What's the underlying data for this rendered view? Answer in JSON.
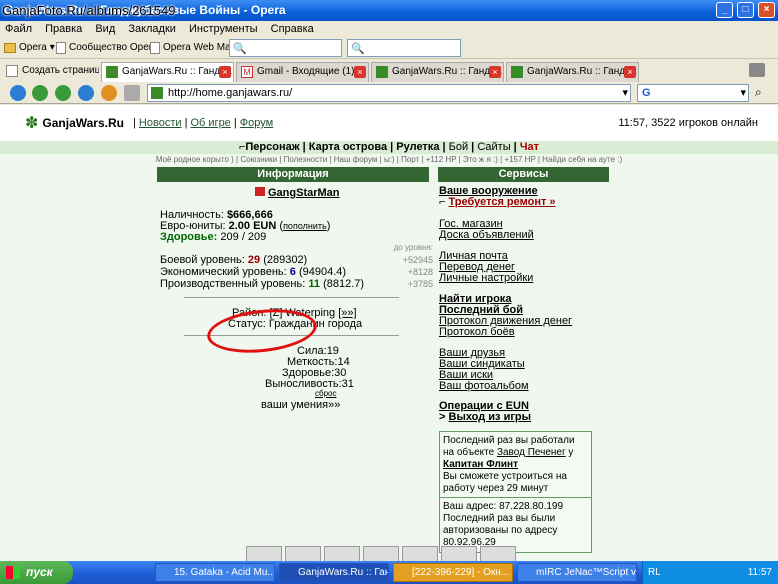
{
  "window": {
    "title": "GanjaWars.Ru :: Ганджубасовые Войны - Opera",
    "watermark": "GanjaFoto.Ru/albums/261549"
  },
  "menu": [
    "Файл",
    "Правка",
    "Вид",
    "Закладки",
    "Инструменты",
    "Справка"
  ],
  "personal_bar": {
    "opera": "Opera",
    "community": "Сообщество Opera",
    "webmail": "Opera Web Mail"
  },
  "tabs": {
    "new_tab": "Создать страницу",
    "items": [
      {
        "label": "GanjaWars.Ru :: Гандж...",
        "active": true
      },
      {
        "label": "Gmail - Входящие (1)",
        "active": false
      },
      {
        "label": "GanjaWars.Ru :: Гандж...",
        "active": false
      },
      {
        "label": "GanjaWars.Ru :: Гандж...",
        "active": false
      }
    ]
  },
  "address": {
    "url": "http://home.ganjawars.ru/",
    "search_engine": "G"
  },
  "site": {
    "logo": "GanjaWars.Ru",
    "links": [
      "Новости",
      "Об игре",
      "Форум"
    ],
    "status": "11:57, 3522 игроков онлайн",
    "nav": [
      "Персонаж",
      "Карта острова",
      "Рулетка",
      "Бой",
      "Сайты",
      "Чат"
    ],
    "subnav": "Моё родное корыто ) | Союзники | Полезности | Наш форум | ы:) | Порт | +112 HP | Это ж я :) | +157 HP | Найди себя на ауте :)"
  },
  "info": {
    "header": "Информация",
    "player": "GangStarMan",
    "cash_label": "Наличность:",
    "cash_value": "$666,666",
    "euro_label": "Евро-юниты:",
    "euro_value": "2.00 EUN",
    "replenish": "пополнить",
    "health_label": "Здоровье:",
    "health_value": "209 / 209",
    "to_level": "до уровня:",
    "combat_label": "Боевой уровень:",
    "combat_level": "29",
    "combat_exp": "(289302)",
    "combat_next": "+52945",
    "econ_label": "Экономический уровень:",
    "econ_level": "6",
    "econ_exp": "(94904.4)",
    "econ_next": "+8128",
    "prod_label": "Производственный уровень:",
    "prod_level": "11",
    "prod_exp": "(8812.7)",
    "prod_next": "+3785",
    "district_label": "Район:",
    "district_value": "[Z] Waterping",
    "district_more": "[»»]",
    "status_label": "Статус:",
    "status_value": "Гражданин города",
    "strength_label": "Сила:",
    "strength": "19",
    "accuracy_label": "Меткость:",
    "accuracy": "14",
    "health2_label": "Здоровье:",
    "health2": "30",
    "endurance_label": "Выносливость:",
    "endurance": "31",
    "reset": "сброс",
    "skills": "ваши умения»»"
  },
  "services": {
    "header": "Сервисы",
    "weapons": "Ваше вооружение",
    "repair": "Требуется ремонт »",
    "gov_shop": "Гос. магазин",
    "board": "Доска объявлений",
    "mail": "Личная почта",
    "transfer": "Перевод денег",
    "settings": "Личные настройки",
    "find_player": "Найти игрока",
    "last_battle": "Последний бой",
    "money_log": "Протокол движения денег",
    "battle_log": "Протокол боёв",
    "friends": "Ваши друзья",
    "syndicates": "Ваши синдикаты",
    "searches": "Ваши иски",
    "photos": "Ваш фотоальбом",
    "eun_ops": "Операции с EUN",
    "logout_prefix": ">",
    "logout": "Выход из игры",
    "work_box": {
      "line1": "Последний раз вы работали на объекте",
      "factory": "Завод Печенег",
      "at": "у",
      "captain": "Капитан Флинт",
      "line2": "Вы сможете устроиться на работу через 29 минут"
    },
    "ip_box": {
      "address": "Ваш адрес: 87.228.80.199",
      "line": "Последний раз вы были авторизованы по адресу",
      "ip": "80.92.96.29"
    }
  },
  "taskbar": {
    "start": "пуск",
    "tasks": [
      {
        "label": "15. Gataka - Acid Mu...",
        "active": false
      },
      {
        "label": "GanjaWars.Ru :: Ган...",
        "active": true
      },
      {
        "label": "[222-396-229] - Окн...",
        "active": false
      },
      {
        "label": "mIRC JeNac™Script v...",
        "active": false
      }
    ],
    "lang": "RL",
    "clock": "11:57"
  },
  "colors": {
    "header_green": "#336633",
    "page_bg": "#f0f7ef",
    "highlight_red": "#e01010"
  }
}
